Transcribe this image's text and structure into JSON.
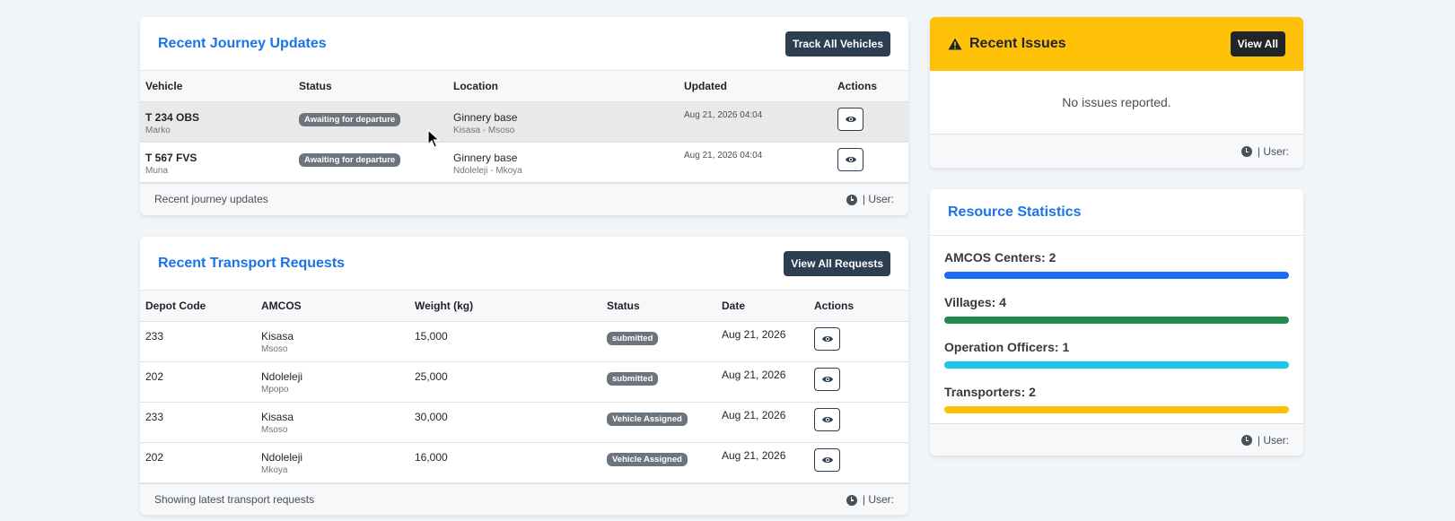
{
  "journey": {
    "title": "Recent Journey Updates",
    "track_btn": "Track All Vehicles",
    "columns": [
      "Vehicle",
      "Status",
      "Location",
      "Updated",
      "Actions"
    ],
    "rows": [
      {
        "vehicle": "T 234 OBS",
        "driver": "Marko",
        "status": "Awaiting for departure",
        "location": "Ginnery base",
        "route": "Kisasa - Msoso",
        "updated": "Aug 21, 2026 04:04"
      },
      {
        "vehicle": "T 567 FVS",
        "driver": "Muna",
        "status": "Awaiting for departure",
        "location": "Ginnery base",
        "route": "Ndoleleji - Mkoya",
        "updated": "Aug 21, 2026 04:04"
      }
    ],
    "footer_text": "Recent journey updates",
    "footer_user": "| User:"
  },
  "transport": {
    "title": "Recent Transport Requests",
    "view_btn": "View All Requests",
    "columns": [
      "Depot Code",
      "AMCOS",
      "Weight (kg)",
      "Status",
      "Date",
      "Actions"
    ],
    "rows": [
      {
        "depot": "233",
        "amcos": "Kisasa",
        "village": "Msoso",
        "weight": "15,000",
        "status": "submitted",
        "date": "Aug 21, 2026"
      },
      {
        "depot": "202",
        "amcos": "Ndoleleji",
        "village": "Mpopo",
        "weight": "25,000",
        "status": "submitted",
        "date": "Aug 21, 2026"
      },
      {
        "depot": "233",
        "amcos": "Kisasa",
        "village": "Msoso",
        "weight": "30,000",
        "status": "Vehicle Assigned",
        "date": "Aug 21, 2026"
      },
      {
        "depot": "202",
        "amcos": "Ndoleleji",
        "village": "Mkoya",
        "weight": "16,000",
        "status": "Vehicle Assigned",
        "date": "Aug 21, 2026"
      }
    ],
    "footer_text": "Showing latest transport requests",
    "footer_user": "| User:"
  },
  "issues": {
    "title": "Recent Issues",
    "view_btn": "View All",
    "empty_text": "No issues reported.",
    "footer_user": "| User:",
    "header_color": "#ffc107"
  },
  "resources": {
    "title": "Resource Statistics",
    "stats": [
      {
        "label": "AMCOS Centers: 2",
        "color": "#1a6ef5"
      },
      {
        "label": "Villages: 4",
        "color": "#1e8a4c"
      },
      {
        "label": "Operation Officers: 1",
        "color": "#1ec6ee"
      },
      {
        "label": "Transporters: 2",
        "color": "#ffc107"
      }
    ],
    "footer_user": "| User:"
  }
}
